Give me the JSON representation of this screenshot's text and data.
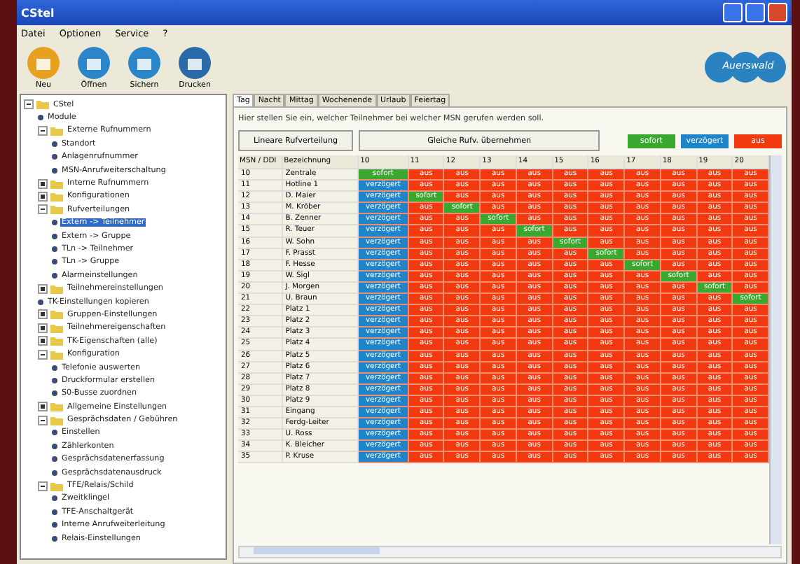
{
  "window": {
    "title": "CStel"
  },
  "menu": [
    "Datei",
    "Optionen",
    "Service",
    "?"
  ],
  "toolbar": [
    {
      "label": "Neu",
      "kind": "new"
    },
    {
      "label": "Öffnen",
      "kind": "open"
    },
    {
      "label": "Sichern",
      "kind": "save"
    },
    {
      "label": "Drucken",
      "kind": "print"
    }
  ],
  "logo": "Auerswald",
  "tree": [
    {
      "label": "CStel",
      "kind": "folder",
      "expanded": true,
      "selected": false,
      "children": [
        {
          "label": "Module",
          "kind": "leaf",
          "selected": false
        },
        {
          "label": "Externe Rufnummern",
          "kind": "folder",
          "expanded": true,
          "selected": false,
          "children": [
            {
              "label": "Standort",
              "kind": "leaf",
              "selected": false
            },
            {
              "label": "Anlagenrufnummer",
              "kind": "leaf",
              "selected": false
            },
            {
              "label": "MSN-Anrufweiterschaltung",
              "kind": "leaf",
              "selected": false
            }
          ]
        },
        {
          "label": "Interne Rufnummern",
          "kind": "folder",
          "expanded": false,
          "selected": false
        },
        {
          "label": "Konfigurationen",
          "kind": "folder",
          "expanded": false,
          "selected": false
        },
        {
          "label": "Rufverteilungen",
          "kind": "folder",
          "expanded": true,
          "selected": false,
          "children": [
            {
              "label": "Extern -> Teilnehmer",
              "kind": "leaf",
              "selected": true
            },
            {
              "label": "Extern -> Gruppe",
              "kind": "leaf",
              "selected": false
            },
            {
              "label": "TLn -> Teilnehmer",
              "kind": "leaf",
              "selected": false
            },
            {
              "label": "TLn -> Gruppe",
              "kind": "leaf",
              "selected": false
            },
            {
              "label": "Alarmeinstellungen",
              "kind": "leaf",
              "selected": false
            }
          ]
        },
        {
          "label": "Teilnehmereinstellungen",
          "kind": "folder",
          "expanded": false,
          "selected": false
        },
        {
          "label": "TK-Einstellungen kopieren",
          "kind": "leaf",
          "selected": false
        },
        {
          "label": "Gruppen-Einstellungen",
          "kind": "folder",
          "expanded": false,
          "selected": false
        },
        {
          "label": "Teilnehmereigenschaften",
          "kind": "folder",
          "expanded": false,
          "selected": false
        },
        {
          "label": "TK-Eigenschaften (alle)",
          "kind": "folder",
          "expanded": false,
          "selected": false
        },
        {
          "label": "Konfiguration",
          "kind": "folder",
          "expanded": true,
          "selected": false,
          "children": [
            {
              "label": "Telefonie auswerten",
              "kind": "leaf",
              "selected": false
            },
            {
              "label": "Druckformular erstellen",
              "kind": "leaf",
              "selected": false
            },
            {
              "label": "S0-Busse zuordnen",
              "kind": "leaf",
              "selected": false
            }
          ]
        },
        {
          "label": "Allgemeine Einstellungen",
          "kind": "folder",
          "expanded": false,
          "selected": false
        },
        {
          "label": "Gesprächsdaten / Gebühren",
          "kind": "folder",
          "expanded": true,
          "selected": false,
          "children": [
            {
              "label": "Einstellen",
              "kind": "leaf",
              "selected": false
            },
            {
              "label": "Zählerkonten",
              "kind": "leaf",
              "selected": false
            },
            {
              "label": "Gesprächsdatenerfassung",
              "kind": "leaf",
              "selected": false
            },
            {
              "label": "Gesprächsdatenausdruck",
              "kind": "leaf",
              "selected": false
            }
          ]
        },
        {
          "label": "TFE/Relais/Schild",
          "kind": "folder",
          "expanded": true,
          "selected": false,
          "children": [
            {
              "label": "Zweitklingel",
              "kind": "leaf",
              "selected": false
            },
            {
              "label": "TFE-Anschaltgerät",
              "kind": "leaf",
              "selected": false
            },
            {
              "label": "Interne Anrufweiterleitung",
              "kind": "leaf",
              "selected": false
            },
            {
              "label": "Relais-Einstellungen",
              "kind": "leaf",
              "selected": false
            }
          ]
        }
      ]
    }
  ],
  "tabs": [
    {
      "label": "Tag",
      "selected": true
    },
    {
      "label": "Nacht",
      "selected": false
    },
    {
      "label": "Mittag",
      "selected": false
    },
    {
      "label": "Wochenende",
      "selected": false
    },
    {
      "label": "Urlaub",
      "selected": false
    },
    {
      "label": "Feiertag",
      "selected": false
    }
  ],
  "hint": "Hier stellen Sie ein, welcher Teilnehmer bei welcher MSN gerufen werden soll.",
  "buttons": [
    "Lineare Rufverteilung",
    "Gleiche Rufv. übernehmen"
  ],
  "legend": [
    {
      "kind": "now",
      "label": "sofort",
      "color": "#3aa82e"
    },
    {
      "kind": "late",
      "label": "verzögert",
      "color": "#1e86c8"
    },
    {
      "kind": "off",
      "label": "aus",
      "color": "#f23a10"
    }
  ],
  "table": {
    "columns": [
      "MSN / DDI",
      "Bezeichnung",
      "10",
      "11",
      "12",
      "13",
      "14",
      "15",
      "16",
      "17",
      "18",
      "19",
      "20"
    ],
    "rows": [
      {
        "number": "10",
        "name": "Zentrale",
        "cells": [
          {
            "text": "sofort",
            "kind": "now"
          },
          {
            "text": "aus",
            "kind": "off"
          },
          {
            "text": "aus",
            "kind": "off"
          },
          {
            "text": "aus",
            "kind": "off"
          },
          {
            "text": "aus",
            "kind": "off"
          },
          {
            "text": "aus",
            "kind": "off"
          },
          {
            "text": "aus",
            "kind": "off"
          },
          {
            "text": "aus",
            "kind": "off"
          },
          {
            "text": "aus",
            "kind": "off"
          },
          {
            "text": "aus",
            "kind": "off"
          },
          {
            "text": "aus",
            "kind": "off"
          }
        ]
      },
      {
        "number": "11",
        "name": "Hotline 1",
        "cells": [
          {
            "text": "verzögert",
            "kind": "late"
          },
          {
            "text": "aus",
            "kind": "off"
          },
          {
            "text": "aus",
            "kind": "off"
          },
          {
            "text": "aus",
            "kind": "off"
          },
          {
            "text": "aus",
            "kind": "off"
          },
          {
            "text": "aus",
            "kind": "off"
          },
          {
            "text": "aus",
            "kind": "off"
          },
          {
            "text": "aus",
            "kind": "off"
          },
          {
            "text": "aus",
            "kind": "off"
          },
          {
            "text": "aus",
            "kind": "off"
          },
          {
            "text": "aus",
            "kind": "off"
          }
        ]
      },
      {
        "number": "12",
        "name": "D. Maier",
        "cells": [
          {
            "text": "verzögert",
            "kind": "late"
          },
          {
            "text": "sofort",
            "kind": "now"
          },
          {
            "text": "aus",
            "kind": "off"
          },
          {
            "text": "aus",
            "kind": "off"
          },
          {
            "text": "aus",
            "kind": "off"
          },
          {
            "text": "aus",
            "kind": "off"
          },
          {
            "text": "aus",
            "kind": "off"
          },
          {
            "text": "aus",
            "kind": "off"
          },
          {
            "text": "aus",
            "kind": "off"
          },
          {
            "text": "aus",
            "kind": "off"
          },
          {
            "text": "aus",
            "kind": "off"
          }
        ]
      },
      {
        "number": "13",
        "name": "M. Kröber",
        "cells": [
          {
            "text": "verzögert",
            "kind": "late"
          },
          {
            "text": "aus",
            "kind": "off"
          },
          {
            "text": "sofort",
            "kind": "now"
          },
          {
            "text": "aus",
            "kind": "off"
          },
          {
            "text": "aus",
            "kind": "off"
          },
          {
            "text": "aus",
            "kind": "off"
          },
          {
            "text": "aus",
            "kind": "off"
          },
          {
            "text": "aus",
            "kind": "off"
          },
          {
            "text": "aus",
            "kind": "off"
          },
          {
            "text": "aus",
            "kind": "off"
          },
          {
            "text": "aus",
            "kind": "off"
          }
        ]
      },
      {
        "number": "14",
        "name": "B. Zenner",
        "cells": [
          {
            "text": "verzögert",
            "kind": "late"
          },
          {
            "text": "aus",
            "kind": "off"
          },
          {
            "text": "aus",
            "kind": "off"
          },
          {
            "text": "sofort",
            "kind": "now"
          },
          {
            "text": "aus",
            "kind": "off"
          },
          {
            "text": "aus",
            "kind": "off"
          },
          {
            "text": "aus",
            "kind": "off"
          },
          {
            "text": "aus",
            "kind": "off"
          },
          {
            "text": "aus",
            "kind": "off"
          },
          {
            "text": "aus",
            "kind": "off"
          },
          {
            "text": "aus",
            "kind": "off"
          }
        ]
      },
      {
        "number": "15",
        "name": "R. Teuer",
        "cells": [
          {
            "text": "verzögert",
            "kind": "late"
          },
          {
            "text": "aus",
            "kind": "off"
          },
          {
            "text": "aus",
            "kind": "off"
          },
          {
            "text": "aus",
            "kind": "off"
          },
          {
            "text": "sofort",
            "kind": "now"
          },
          {
            "text": "aus",
            "kind": "off"
          },
          {
            "text": "aus",
            "kind": "off"
          },
          {
            "text": "aus",
            "kind": "off"
          },
          {
            "text": "aus",
            "kind": "off"
          },
          {
            "text": "aus",
            "kind": "off"
          },
          {
            "text": "aus",
            "kind": "off"
          }
        ]
      },
      {
        "number": "16",
        "name": "W. Sohn",
        "cells": [
          {
            "text": "verzögert",
            "kind": "late"
          },
          {
            "text": "aus",
            "kind": "off"
          },
          {
            "text": "aus",
            "kind": "off"
          },
          {
            "text": "aus",
            "kind": "off"
          },
          {
            "text": "aus",
            "kind": "off"
          },
          {
            "text": "sofort",
            "kind": "now"
          },
          {
            "text": "aus",
            "kind": "off"
          },
          {
            "text": "aus",
            "kind": "off"
          },
          {
            "text": "aus",
            "kind": "off"
          },
          {
            "text": "aus",
            "kind": "off"
          },
          {
            "text": "aus",
            "kind": "off"
          }
        ]
      },
      {
        "number": "17",
        "name": "F. Prasst",
        "cells": [
          {
            "text": "verzögert",
            "kind": "late"
          },
          {
            "text": "aus",
            "kind": "off"
          },
          {
            "text": "aus",
            "kind": "off"
          },
          {
            "text": "aus",
            "kind": "off"
          },
          {
            "text": "aus",
            "kind": "off"
          },
          {
            "text": "aus",
            "kind": "off"
          },
          {
            "text": "sofort",
            "kind": "now"
          },
          {
            "text": "aus",
            "kind": "off"
          },
          {
            "text": "aus",
            "kind": "off"
          },
          {
            "text": "aus",
            "kind": "off"
          },
          {
            "text": "aus",
            "kind": "off"
          }
        ]
      },
      {
        "number": "18",
        "name": "F. Hesse",
        "cells": [
          {
            "text": "verzögert",
            "kind": "late"
          },
          {
            "text": "aus",
            "kind": "off"
          },
          {
            "text": "aus",
            "kind": "off"
          },
          {
            "text": "aus",
            "kind": "off"
          },
          {
            "text": "aus",
            "kind": "off"
          },
          {
            "text": "aus",
            "kind": "off"
          },
          {
            "text": "aus",
            "kind": "off"
          },
          {
            "text": "sofort",
            "kind": "now"
          },
          {
            "text": "aus",
            "kind": "off"
          },
          {
            "text": "aus",
            "kind": "off"
          },
          {
            "text": "aus",
            "kind": "off"
          }
        ]
      },
      {
        "number": "19",
        "name": "W. Sigl",
        "cells": [
          {
            "text": "verzögert",
            "kind": "late"
          },
          {
            "text": "aus",
            "kind": "off"
          },
          {
            "text": "aus",
            "kind": "off"
          },
          {
            "text": "aus",
            "kind": "off"
          },
          {
            "text": "aus",
            "kind": "off"
          },
          {
            "text": "aus",
            "kind": "off"
          },
          {
            "text": "aus",
            "kind": "off"
          },
          {
            "text": "aus",
            "kind": "off"
          },
          {
            "text": "sofort",
            "kind": "now"
          },
          {
            "text": "aus",
            "kind": "off"
          },
          {
            "text": "aus",
            "kind": "off"
          }
        ]
      },
      {
        "number": "20",
        "name": "J. Morgen",
        "cells": [
          {
            "text": "verzögert",
            "kind": "late"
          },
          {
            "text": "aus",
            "kind": "off"
          },
          {
            "text": "aus",
            "kind": "off"
          },
          {
            "text": "aus",
            "kind": "off"
          },
          {
            "text": "aus",
            "kind": "off"
          },
          {
            "text": "aus",
            "kind": "off"
          },
          {
            "text": "aus",
            "kind": "off"
          },
          {
            "text": "aus",
            "kind": "off"
          },
          {
            "text": "aus",
            "kind": "off"
          },
          {
            "text": "sofort",
            "kind": "now"
          },
          {
            "text": "aus",
            "kind": "off"
          }
        ]
      },
      {
        "number": "21",
        "name": "U. Braun",
        "cells": [
          {
            "text": "verzögert",
            "kind": "late"
          },
          {
            "text": "aus",
            "kind": "off"
          },
          {
            "text": "aus",
            "kind": "off"
          },
          {
            "text": "aus",
            "kind": "off"
          },
          {
            "text": "aus",
            "kind": "off"
          },
          {
            "text": "aus",
            "kind": "off"
          },
          {
            "text": "aus",
            "kind": "off"
          },
          {
            "text": "aus",
            "kind": "off"
          },
          {
            "text": "aus",
            "kind": "off"
          },
          {
            "text": "aus",
            "kind": "off"
          },
          {
            "text": "sofort",
            "kind": "now"
          }
        ]
      },
      {
        "number": "22",
        "name": "Platz 1",
        "cells": [
          {
            "text": "verzögert",
            "kind": "late"
          },
          {
            "text": "aus",
            "kind": "off"
          },
          {
            "text": "aus",
            "kind": "off"
          },
          {
            "text": "aus",
            "kind": "off"
          },
          {
            "text": "aus",
            "kind": "off"
          },
          {
            "text": "aus",
            "kind": "off"
          },
          {
            "text": "aus",
            "kind": "off"
          },
          {
            "text": "aus",
            "kind": "off"
          },
          {
            "text": "aus",
            "kind": "off"
          },
          {
            "text": "aus",
            "kind": "off"
          },
          {
            "text": "aus",
            "kind": "off"
          }
        ]
      },
      {
        "number": "23",
        "name": "Platz 2",
        "cells": [
          {
            "text": "verzögert",
            "kind": "late"
          },
          {
            "text": "aus",
            "kind": "off"
          },
          {
            "text": "aus",
            "kind": "off"
          },
          {
            "text": "aus",
            "kind": "off"
          },
          {
            "text": "aus",
            "kind": "off"
          },
          {
            "text": "aus",
            "kind": "off"
          },
          {
            "text": "aus",
            "kind": "off"
          },
          {
            "text": "aus",
            "kind": "off"
          },
          {
            "text": "aus",
            "kind": "off"
          },
          {
            "text": "aus",
            "kind": "off"
          },
          {
            "text": "aus",
            "kind": "off"
          }
        ]
      },
      {
        "number": "24",
        "name": "Platz 3",
        "cells": [
          {
            "text": "verzögert",
            "kind": "late"
          },
          {
            "text": "aus",
            "kind": "off"
          },
          {
            "text": "aus",
            "kind": "off"
          },
          {
            "text": "aus",
            "kind": "off"
          },
          {
            "text": "aus",
            "kind": "off"
          },
          {
            "text": "aus",
            "kind": "off"
          },
          {
            "text": "aus",
            "kind": "off"
          },
          {
            "text": "aus",
            "kind": "off"
          },
          {
            "text": "aus",
            "kind": "off"
          },
          {
            "text": "aus",
            "kind": "off"
          },
          {
            "text": "aus",
            "kind": "off"
          }
        ]
      },
      {
        "number": "25",
        "name": "Platz 4",
        "cells": [
          {
            "text": "verzögert",
            "kind": "late"
          },
          {
            "text": "aus",
            "kind": "off"
          },
          {
            "text": "aus",
            "kind": "off"
          },
          {
            "text": "aus",
            "kind": "off"
          },
          {
            "text": "aus",
            "kind": "off"
          },
          {
            "text": "aus",
            "kind": "off"
          },
          {
            "text": "aus",
            "kind": "off"
          },
          {
            "text": "aus",
            "kind": "off"
          },
          {
            "text": "aus",
            "kind": "off"
          },
          {
            "text": "aus",
            "kind": "off"
          },
          {
            "text": "aus",
            "kind": "off"
          }
        ]
      },
      {
        "number": "26",
        "name": "Platz 5",
        "cells": [
          {
            "text": "verzögert",
            "kind": "late"
          },
          {
            "text": "aus",
            "kind": "off"
          },
          {
            "text": "aus",
            "kind": "off"
          },
          {
            "text": "aus",
            "kind": "off"
          },
          {
            "text": "aus",
            "kind": "off"
          },
          {
            "text": "aus",
            "kind": "off"
          },
          {
            "text": "aus",
            "kind": "off"
          },
          {
            "text": "aus",
            "kind": "off"
          },
          {
            "text": "aus",
            "kind": "off"
          },
          {
            "text": "aus",
            "kind": "off"
          },
          {
            "text": "aus",
            "kind": "off"
          }
        ]
      },
      {
        "number": "27",
        "name": "Platz 6",
        "cells": [
          {
            "text": "verzögert",
            "kind": "late"
          },
          {
            "text": "aus",
            "kind": "off"
          },
          {
            "text": "aus",
            "kind": "off"
          },
          {
            "text": "aus",
            "kind": "off"
          },
          {
            "text": "aus",
            "kind": "off"
          },
          {
            "text": "aus",
            "kind": "off"
          },
          {
            "text": "aus",
            "kind": "off"
          },
          {
            "text": "aus",
            "kind": "off"
          },
          {
            "text": "aus",
            "kind": "off"
          },
          {
            "text": "aus",
            "kind": "off"
          },
          {
            "text": "aus",
            "kind": "off"
          }
        ]
      },
      {
        "number": "28",
        "name": "Platz 7",
        "cells": [
          {
            "text": "verzögert",
            "kind": "late"
          },
          {
            "text": "aus",
            "kind": "off"
          },
          {
            "text": "aus",
            "kind": "off"
          },
          {
            "text": "aus",
            "kind": "off"
          },
          {
            "text": "aus",
            "kind": "off"
          },
          {
            "text": "aus",
            "kind": "off"
          },
          {
            "text": "aus",
            "kind": "off"
          },
          {
            "text": "aus",
            "kind": "off"
          },
          {
            "text": "aus",
            "kind": "off"
          },
          {
            "text": "aus",
            "kind": "off"
          },
          {
            "text": "aus",
            "kind": "off"
          }
        ]
      },
      {
        "number": "29",
        "name": "Platz 8",
        "cells": [
          {
            "text": "verzögert",
            "kind": "late"
          },
          {
            "text": "aus",
            "kind": "off"
          },
          {
            "text": "aus",
            "kind": "off"
          },
          {
            "text": "aus",
            "kind": "off"
          },
          {
            "text": "aus",
            "kind": "off"
          },
          {
            "text": "aus",
            "kind": "off"
          },
          {
            "text": "aus",
            "kind": "off"
          },
          {
            "text": "aus",
            "kind": "off"
          },
          {
            "text": "aus",
            "kind": "off"
          },
          {
            "text": "aus",
            "kind": "off"
          },
          {
            "text": "aus",
            "kind": "off"
          }
        ]
      },
      {
        "number": "30",
        "name": "Platz 9",
        "cells": [
          {
            "text": "verzögert",
            "kind": "late"
          },
          {
            "text": "aus",
            "kind": "off"
          },
          {
            "text": "aus",
            "kind": "off"
          },
          {
            "text": "aus",
            "kind": "off"
          },
          {
            "text": "aus",
            "kind": "off"
          },
          {
            "text": "aus",
            "kind": "off"
          },
          {
            "text": "aus",
            "kind": "off"
          },
          {
            "text": "aus",
            "kind": "off"
          },
          {
            "text": "aus",
            "kind": "off"
          },
          {
            "text": "aus",
            "kind": "off"
          },
          {
            "text": "aus",
            "kind": "off"
          }
        ]
      },
      {
        "number": "31",
        "name": "Eingang",
        "cells": [
          {
            "text": "verzögert",
            "kind": "late"
          },
          {
            "text": "aus",
            "kind": "off"
          },
          {
            "text": "aus",
            "kind": "off"
          },
          {
            "text": "aus",
            "kind": "off"
          },
          {
            "text": "aus",
            "kind": "off"
          },
          {
            "text": "aus",
            "kind": "off"
          },
          {
            "text": "aus",
            "kind": "off"
          },
          {
            "text": "aus",
            "kind": "off"
          },
          {
            "text": "aus",
            "kind": "off"
          },
          {
            "text": "aus",
            "kind": "off"
          },
          {
            "text": "aus",
            "kind": "off"
          }
        ]
      },
      {
        "number": "32",
        "name": "Ferdg-Leiter",
        "cells": [
          {
            "text": "verzögert",
            "kind": "late"
          },
          {
            "text": "aus",
            "kind": "off"
          },
          {
            "text": "aus",
            "kind": "off"
          },
          {
            "text": "aus",
            "kind": "off"
          },
          {
            "text": "aus",
            "kind": "off"
          },
          {
            "text": "aus",
            "kind": "off"
          },
          {
            "text": "aus",
            "kind": "off"
          },
          {
            "text": "aus",
            "kind": "off"
          },
          {
            "text": "aus",
            "kind": "off"
          },
          {
            "text": "aus",
            "kind": "off"
          },
          {
            "text": "aus",
            "kind": "off"
          }
        ]
      },
      {
        "number": "33",
        "name": "U. Ross",
        "cells": [
          {
            "text": "verzögert",
            "kind": "late"
          },
          {
            "text": "aus",
            "kind": "off"
          },
          {
            "text": "aus",
            "kind": "off"
          },
          {
            "text": "aus",
            "kind": "off"
          },
          {
            "text": "aus",
            "kind": "off"
          },
          {
            "text": "aus",
            "kind": "off"
          },
          {
            "text": "aus",
            "kind": "off"
          },
          {
            "text": "aus",
            "kind": "off"
          },
          {
            "text": "aus",
            "kind": "off"
          },
          {
            "text": "aus",
            "kind": "off"
          },
          {
            "text": "aus",
            "kind": "off"
          }
        ]
      },
      {
        "number": "34",
        "name": "K. Bleicher",
        "cells": [
          {
            "text": "verzögert",
            "kind": "late"
          },
          {
            "text": "aus",
            "kind": "off"
          },
          {
            "text": "aus",
            "kind": "off"
          },
          {
            "text": "aus",
            "kind": "off"
          },
          {
            "text": "aus",
            "kind": "off"
          },
          {
            "text": "aus",
            "kind": "off"
          },
          {
            "text": "aus",
            "kind": "off"
          },
          {
            "text": "aus",
            "kind": "off"
          },
          {
            "text": "aus",
            "kind": "off"
          },
          {
            "text": "aus",
            "kind": "off"
          },
          {
            "text": "aus",
            "kind": "off"
          }
        ]
      },
      {
        "number": "35",
        "name": "P. Kruse",
        "cells": [
          {
            "text": "verzögert",
            "kind": "late"
          },
          {
            "text": "aus",
            "kind": "off"
          },
          {
            "text": "aus",
            "kind": "off"
          },
          {
            "text": "aus",
            "kind": "off"
          },
          {
            "text": "aus",
            "kind": "off"
          },
          {
            "text": "aus",
            "kind": "off"
          },
          {
            "text": "aus",
            "kind": "off"
          },
          {
            "text": "aus",
            "kind": "off"
          },
          {
            "text": "aus",
            "kind": "off"
          },
          {
            "text": "aus",
            "kind": "off"
          },
          {
            "text": "aus",
            "kind": "off"
          }
        ]
      }
    ]
  }
}
